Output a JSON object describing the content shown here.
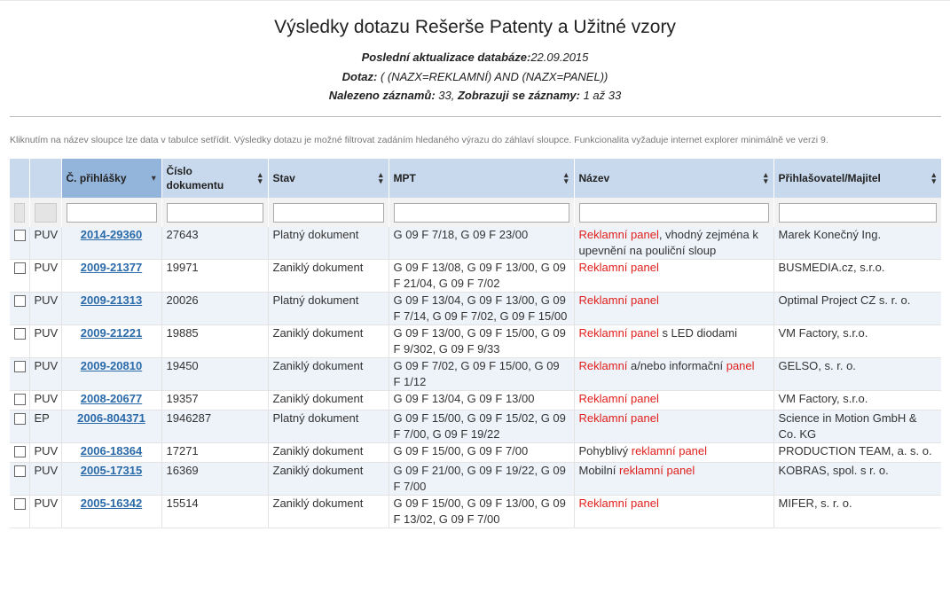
{
  "header": {
    "title": "Výsledky dotazu Rešerše Patenty a Užitné vzory",
    "db_update_label": "Poslední aktualizace databáze:",
    "db_update_value": "22.09.2015",
    "query_label": "Dotaz:",
    "query_value": " ( (NAZX=REKLAMNÍ) AND (NAZX=PANEL))",
    "found_label": "Nalezeno záznamů:",
    "found_value": " 33, ",
    "showing_label": "Zobrazuji se záznamy:",
    "showing_value": " 1 až 33"
  },
  "note": "Kliknutím na název sloupce lze data v tabulce setřídit. Výsledky dotazu je možné filtrovat zadáním hledaného výrazu do záhlaví sloupce. Funkcionalita vyžaduje internet explorer minimálně ve verzi 9.",
  "columns": {
    "app_no": "Č. přihlášky",
    "doc_no": "Číslo dokumentu",
    "status": "Stav",
    "ipc": "MPT",
    "name": "Název",
    "owner": "Přihlašovatel/Majitel"
  },
  "rows": [
    {
      "type": "PUV",
      "app_no": "2014-29360",
      "doc_no": "27643",
      "status": "Platný dokument",
      "ipc": "G 09 F 7/18, G 09 F 23/00",
      "name": [
        {
          "t": "Reklamní panel",
          "hl": true
        },
        {
          "t": ", vhodný zejména k upevnění na pouliční sloup",
          "hl": false
        }
      ],
      "owner": "Marek Konečný Ing."
    },
    {
      "type": "PUV",
      "app_no": "2009-21377",
      "doc_no": "19971",
      "status": "Zaniklý dokument",
      "ipc": "G 09 F 13/08, G 09 F 13/00, G 09 F 21/04, G 09 F 7/02",
      "name": [
        {
          "t": "Reklamní panel",
          "hl": true
        }
      ],
      "owner": "BUSMEDIA.cz, s.r.o."
    },
    {
      "type": "PUV",
      "app_no": "2009-21313",
      "doc_no": "20026",
      "status": "Platný dokument",
      "ipc": "G 09 F 13/04, G 09 F 13/00, G 09 F 7/14, G 09 F 7/02, G 09 F 15/00",
      "name": [
        {
          "t": "Reklamní panel",
          "hl": true
        }
      ],
      "owner": "Optimal Project CZ s. r. o."
    },
    {
      "type": "PUV",
      "app_no": "2009-21221",
      "doc_no": "19885",
      "status": "Zaniklý dokument",
      "ipc": "G 09 F 13/00, G 09 F 15/00, G 09 F 9/302, G 09 F 9/33",
      "name": [
        {
          "t": "Reklamní panel",
          "hl": true
        },
        {
          "t": " s LED diodami",
          "hl": false
        }
      ],
      "owner": "VM Factory, s.r.o."
    },
    {
      "type": "PUV",
      "app_no": "2009-20810",
      "doc_no": "19450",
      "status": "Zaniklý dokument",
      "ipc": "G 09 F 7/02, G 09 F 15/00, G 09 F 1/12",
      "name": [
        {
          "t": "Reklamní",
          "hl": true
        },
        {
          "t": " a/nebo informační ",
          "hl": false
        },
        {
          "t": "panel",
          "hl": true
        }
      ],
      "owner": "GELSO, s. r. o."
    },
    {
      "type": "PUV",
      "app_no": "2008-20677",
      "doc_no": "19357",
      "status": "Zaniklý dokument",
      "ipc": "G 09 F 13/04, G 09 F 13/00",
      "name": [
        {
          "t": "Reklamní panel",
          "hl": true
        }
      ],
      "owner": "VM Factory, s.r.o."
    },
    {
      "type": "EP",
      "app_no": "2006-804371",
      "doc_no": "1946287",
      "status": "Platný dokument",
      "ipc": "G 09 F 15/00, G 09 F 15/02, G 09 F 7/00, G 09 F 19/22",
      "name": [
        {
          "t": "Reklamní panel",
          "hl": true
        }
      ],
      "owner": "Science in Motion GmbH & Co. KG"
    },
    {
      "type": "PUV",
      "app_no": "2006-18364",
      "doc_no": "17271",
      "status": "Zaniklý dokument",
      "ipc": "G 09 F 15/00, G 09 F 7/00",
      "name": [
        {
          "t": "Pohyblivý ",
          "hl": false
        },
        {
          "t": "reklamní panel",
          "hl": true
        }
      ],
      "owner": "PRODUCTION TEAM, a. s. o."
    },
    {
      "type": "PUV",
      "app_no": "2005-17315",
      "doc_no": "16369",
      "status": "Zaniklý dokument",
      "ipc": "G 09 F 21/00, G 09 F 19/22, G 09 F 7/00",
      "name": [
        {
          "t": "Mobilní ",
          "hl": false
        },
        {
          "t": "reklamní panel",
          "hl": true
        }
      ],
      "owner": "KOBRAS, spol. s r. o."
    },
    {
      "type": "PUV",
      "app_no": "2005-16342",
      "doc_no": "15514",
      "status": "Zaniklý dokument",
      "ipc": "G 09 F 15/00, G 09 F 13/00, G 09 F 13/02, G 09 F 7/00",
      "name": [
        {
          "t": "Reklamní panel",
          "hl": true
        }
      ],
      "owner": "MIFER, s. r. o."
    }
  ],
  "colors": {
    "highlight": "#e0201c",
    "link": "#2a6aa8",
    "header_bg": "#c8d9ed",
    "header_sorted_bg": "#93b4db",
    "row_alt_bg": "#eef3fa"
  }
}
